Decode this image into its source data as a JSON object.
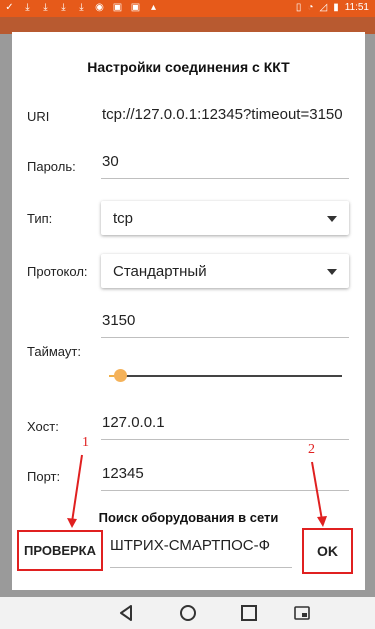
{
  "status_bar": {
    "time": "11:51",
    "left_icons": [
      "check-icon",
      "download-icon",
      "download-icon",
      "download-icon",
      "download-icon",
      "eye-icon",
      "app-icon",
      "app-icon",
      "android-icon"
    ],
    "right_icons": [
      "vibrate-icon",
      "wifi-icon",
      "no-sim-icon",
      "battery-icon"
    ]
  },
  "dialog": {
    "title": "Настройки соединения с ККТ",
    "uri_label": "URI",
    "uri_value": "tcp://127.0.0.1:12345?timeout=3150",
    "password_label": "Пароль:",
    "password_value": "30",
    "type_label": "Тип:",
    "type_value": "tcp",
    "protocol_label": "Протокол:",
    "protocol_value": "Стандартный",
    "timeout_value": "3150",
    "timeout_label": "Таймаут:",
    "timeout_slider_fraction": 0.05,
    "host_label": "Хост:",
    "host_value": "127.0.0.1",
    "port_label": "Порт:",
    "port_value": "12345",
    "search_caption": "Поиск оборудования в сети",
    "check_button": "ПРОВЕРКА",
    "device_value": "ШТРИХ-СМАРТПОС-Ф",
    "ok_button": "OK"
  },
  "annotations": {
    "marker_1": "1",
    "marker_2": "2",
    "color": "#e02020"
  },
  "nav_bar": {
    "icons": [
      "back-icon",
      "home-icon",
      "recents-icon",
      "screenshot-icon"
    ]
  },
  "colors": {
    "status_bar": "#e65a1a",
    "accent_thumb": "#f4b25a"
  }
}
